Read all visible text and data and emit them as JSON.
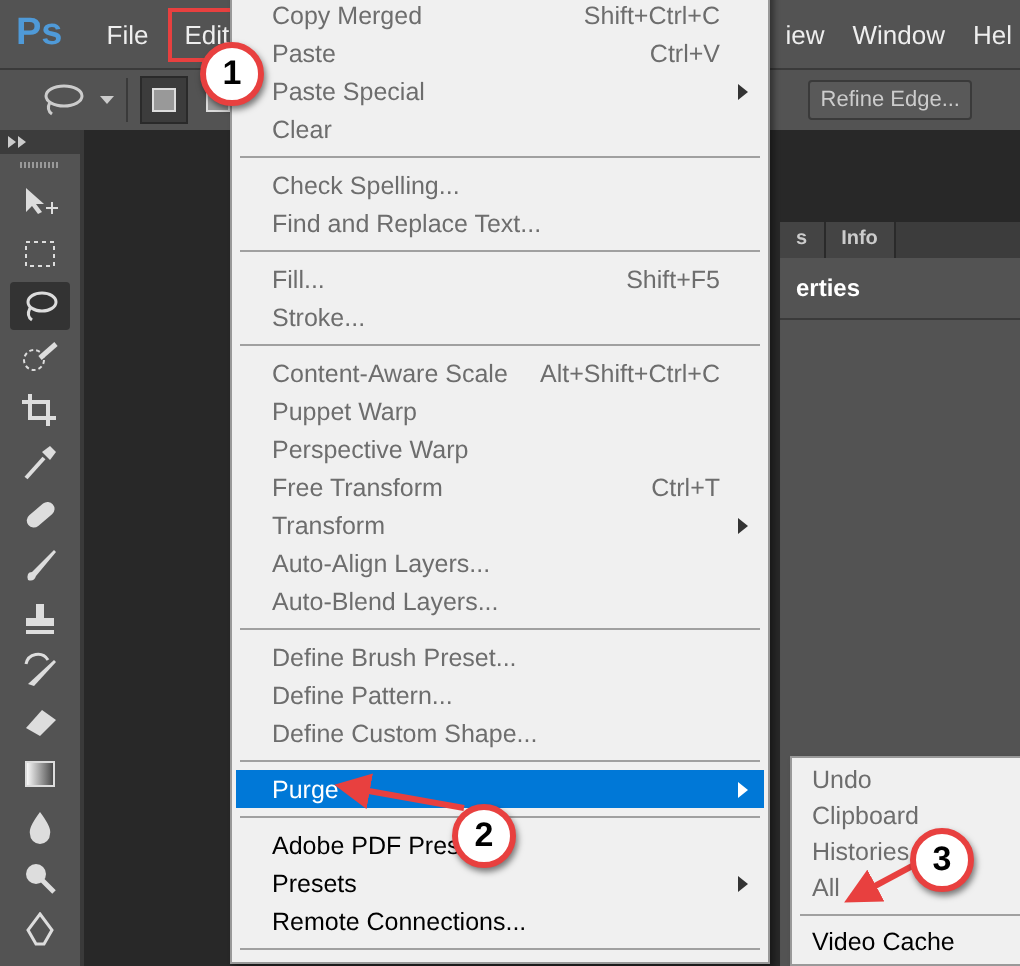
{
  "app": {
    "logo": "Ps"
  },
  "menubar": [
    {
      "label": "File",
      "highlighted": false
    },
    {
      "label": "Edit",
      "highlighted": true
    },
    {
      "label": "iew",
      "highlighted": false
    },
    {
      "label": "Window",
      "highlighted": false
    },
    {
      "label": "Hel",
      "highlighted": false
    }
  ],
  "options_bar": {
    "refine_button": "Refine Edge..."
  },
  "panel": {
    "tabs": [
      {
        "label": "s",
        "selected": false
      },
      {
        "label": "Info",
        "selected": false
      }
    ],
    "title": "erties"
  },
  "edit_menu": {
    "items": [
      {
        "kind": "item",
        "label": "Copy Merged",
        "shortcut": "Shift+Ctrl+C",
        "disabled": true,
        "submenu": false,
        "selected": false
      },
      {
        "kind": "item",
        "label": "Paste",
        "shortcut": "Ctrl+V",
        "disabled": true,
        "submenu": false,
        "selected": false
      },
      {
        "kind": "item",
        "label": "Paste Special",
        "disabled": true,
        "submenu": true,
        "selected": false
      },
      {
        "kind": "item",
        "label": "Clear",
        "disabled": true,
        "submenu": false,
        "selected": false
      },
      {
        "kind": "separator"
      },
      {
        "kind": "item",
        "label": "Check Spelling...",
        "disabled": true,
        "submenu": false,
        "selected": false
      },
      {
        "kind": "item",
        "label": "Find and Replace Text...",
        "disabled": true,
        "submenu": false,
        "selected": false
      },
      {
        "kind": "separator"
      },
      {
        "kind": "item",
        "label": "Fill...",
        "shortcut": "Shift+F5",
        "disabled": true,
        "submenu": false,
        "selected": false
      },
      {
        "kind": "item",
        "label": "Stroke...",
        "disabled": true,
        "submenu": false,
        "selected": false
      },
      {
        "kind": "separator"
      },
      {
        "kind": "item",
        "label": "Content-Aware Scale",
        "shortcut": "Alt+Shift+Ctrl+C",
        "disabled": true,
        "submenu": false,
        "selected": false
      },
      {
        "kind": "item",
        "label": "Puppet Warp",
        "disabled": true,
        "submenu": false,
        "selected": false
      },
      {
        "kind": "item",
        "label": "Perspective Warp",
        "disabled": true,
        "submenu": false,
        "selected": false
      },
      {
        "kind": "item",
        "label": "Free Transform",
        "shortcut": "Ctrl+T",
        "disabled": true,
        "submenu": false,
        "selected": false
      },
      {
        "kind": "item",
        "label": "Transform",
        "disabled": true,
        "submenu": true,
        "selected": false
      },
      {
        "kind": "item",
        "label": "Auto-Align Layers...",
        "disabled": true,
        "submenu": false,
        "selected": false
      },
      {
        "kind": "item",
        "label": "Auto-Blend Layers...",
        "disabled": true,
        "submenu": false,
        "selected": false
      },
      {
        "kind": "separator"
      },
      {
        "kind": "item",
        "label": "Define Brush Preset...",
        "disabled": true,
        "submenu": false,
        "selected": false
      },
      {
        "kind": "item",
        "label": "Define Pattern...",
        "disabled": true,
        "submenu": false,
        "selected": false
      },
      {
        "kind": "item",
        "label": "Define Custom Shape...",
        "disabled": true,
        "submenu": false,
        "selected": false
      },
      {
        "kind": "separator"
      },
      {
        "kind": "item",
        "label": "Purge",
        "disabled": false,
        "submenu": true,
        "selected": true
      },
      {
        "kind": "separator"
      },
      {
        "kind": "item",
        "label": "Adobe PDF Pres",
        "disabled": false,
        "submenu": false,
        "selected": false
      },
      {
        "kind": "item",
        "label": "Presets",
        "disabled": false,
        "submenu": true,
        "selected": false
      },
      {
        "kind": "item",
        "label": "Remote Connections...",
        "disabled": false,
        "submenu": false,
        "selected": false
      },
      {
        "kind": "separator"
      }
    ]
  },
  "purge_submenu": {
    "items": [
      {
        "kind": "item",
        "label": "Undo",
        "disabled": true
      },
      {
        "kind": "item",
        "label": "Clipboard",
        "disabled": true
      },
      {
        "kind": "item",
        "label": "Histories",
        "disabled": true
      },
      {
        "kind": "item",
        "label": "All",
        "disabled": true
      },
      {
        "kind": "separator"
      },
      {
        "kind": "item",
        "label": "Video Cache",
        "disabled": false
      }
    ]
  },
  "callouts": [
    {
      "number": "1"
    },
    {
      "number": "2"
    },
    {
      "number": "3"
    }
  ]
}
